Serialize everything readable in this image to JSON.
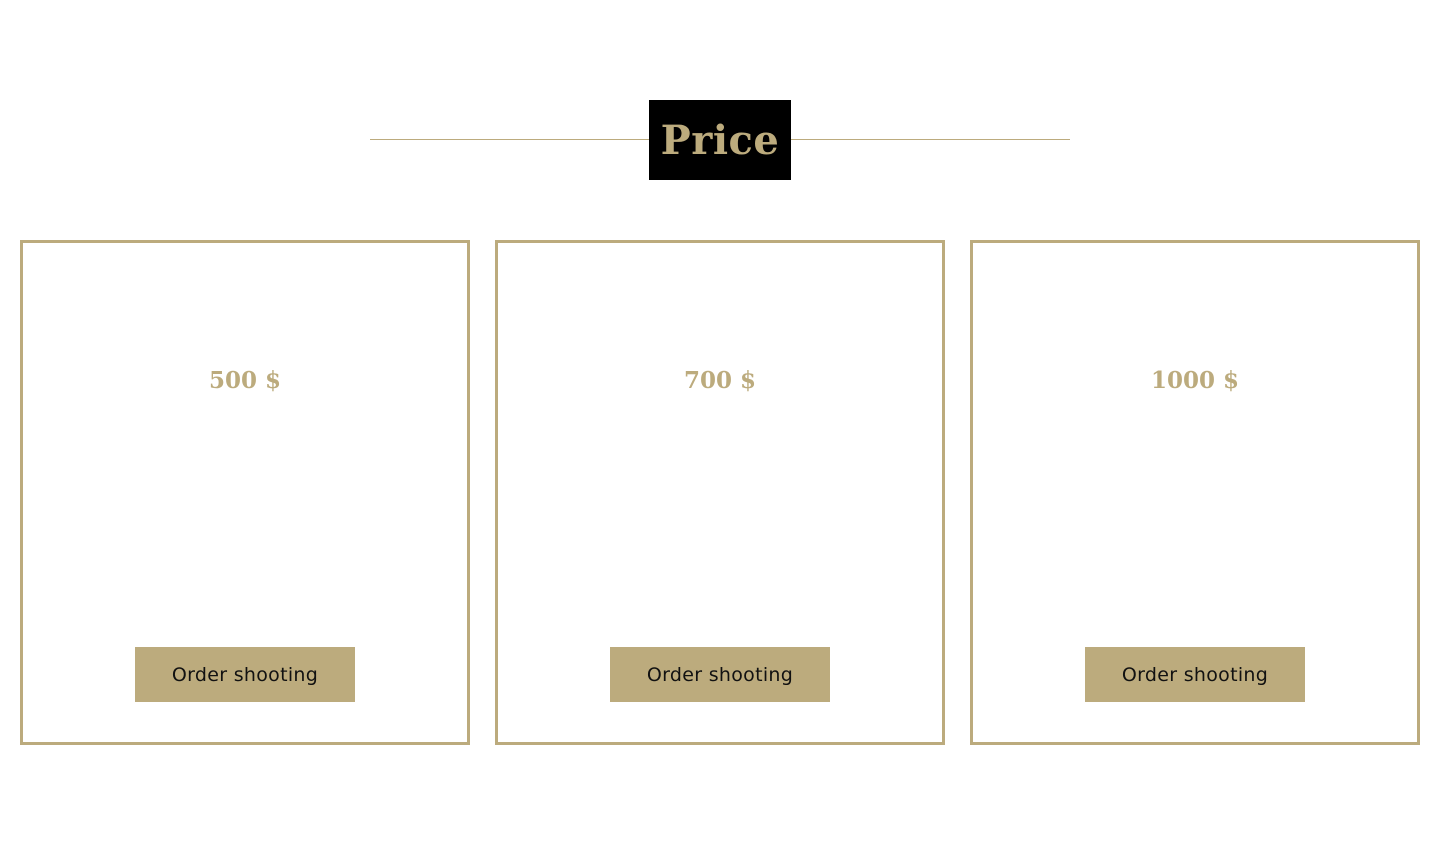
{
  "section": {
    "title": "Price"
  },
  "plans": [
    {
      "price": "500 $",
      "button_label": "Order shooting"
    },
    {
      "price": "700 $",
      "button_label": "Order shooting"
    },
    {
      "price": "1000 $",
      "button_label": "Order shooting"
    }
  ],
  "colors": {
    "accent": "#bcab7d",
    "heading_background": "#000000",
    "page_background": "#ffffff",
    "button_text": "#111111"
  }
}
